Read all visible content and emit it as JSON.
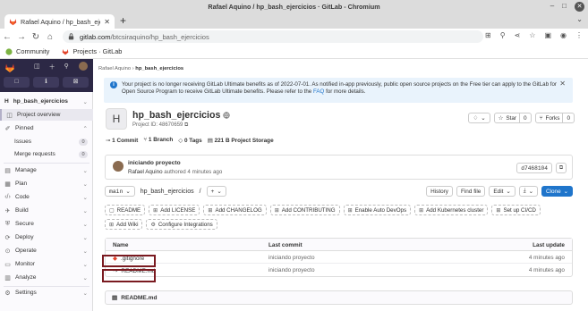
{
  "window": {
    "title": "Rafael Aquino / hp_bash_ejercicios · GitLab - Chromium"
  },
  "tab": {
    "label": "Rafael Aquino / hp_bash_ejercicios",
    "new_tab": "+"
  },
  "address": {
    "url_host": "gitlab.com",
    "url_path": "/btcsiraquino/hp_bash_ejercicios"
  },
  "bookmarks": [
    {
      "label": "Community"
    },
    {
      "label": "Projects · GitLab"
    }
  ],
  "sidebar": {
    "project": "hp_bash_ejercicios",
    "topbuttons": [
      "□",
      "ℹ",
      "⊠"
    ],
    "items": [
      {
        "label": "Project overview",
        "icon": "◫"
      },
      {
        "label": "Pinned",
        "icon": "✐"
      },
      {
        "label": "Issues",
        "count": "0"
      },
      {
        "label": "Merge requests",
        "count": "0"
      },
      {
        "label": "Manage",
        "icon": "▤"
      },
      {
        "label": "Plan",
        "icon": "▦"
      },
      {
        "label": "Code",
        "icon": "‹/›"
      },
      {
        "label": "Build",
        "icon": "✈"
      },
      {
        "label": "Secure",
        "icon": "⛨"
      },
      {
        "label": "Deploy",
        "icon": "⟳"
      },
      {
        "label": "Operate",
        "icon": "⊙"
      },
      {
        "label": "Monitor",
        "icon": "▭"
      },
      {
        "label": "Analyze",
        "icon": "▥"
      },
      {
        "label": "Settings",
        "icon": "⚙"
      }
    ]
  },
  "breadcrumb": {
    "user": "Rafael Aquino",
    "sep": "›",
    "project": "hp_bash_ejercicios"
  },
  "alert": {
    "text": "Your project is no longer receiving GitLab Ultimate benefits as of 2022-07-01. As notified in-app previously, public open source projects on the Free tier can apply to the GitLab for Open Source Program to receive GitLab Ultimate benefits. Please refer to the",
    "link": "FAQ",
    "text_end": "for more details."
  },
  "project": {
    "avatar_letter": "H",
    "name": "hp_bash_ejercicios",
    "id_label": "Project ID: 48670659",
    "star_label": "Star",
    "star_count": "0",
    "forks_label": "Forks",
    "forks_count": "0"
  },
  "stats": {
    "commits": "1 Commit",
    "branches": "1 Branch",
    "tags": "0 Tags",
    "storage_value": "221 B",
    "storage_label": "Project Storage"
  },
  "commit": {
    "title": "iniciando proyecto",
    "author": "Rafael Aquino",
    "authored": "authored 4 minutes ago",
    "sha": "d7468104"
  },
  "repo": {
    "branch": "main",
    "path": "hp_bash_ejercicios",
    "path_sep": "/",
    "add": "+",
    "history": "History",
    "find_file": "Find file",
    "edit": "Edit",
    "download": "⤓",
    "clone": "Clone"
  },
  "quick_buttons": [
    "README",
    "Add LICENSE",
    "Add CHANGELOG",
    "Add CONTRIBUTING",
    "Enable Auto DevOps",
    "Add Kubernetes cluster",
    "Set up CI/CD",
    "Add Wiki",
    "Configure Integrations"
  ],
  "table": {
    "headers": {
      "name": "Name",
      "commit": "Last commit",
      "update": "Last update"
    },
    "rows": [
      {
        "name": ".gitignore",
        "commit": "iniciando proyecto",
        "update": "4 minutes ago"
      },
      {
        "name": "README.md",
        "commit": "iniciando proyecto",
        "update": "4 minutes ago"
      }
    ]
  },
  "readme": {
    "label": "README.md"
  },
  "colors": {
    "accent": "#1f75cb",
    "sidebar_dark": "#2c2845",
    "highlight": "#7a1a20"
  }
}
